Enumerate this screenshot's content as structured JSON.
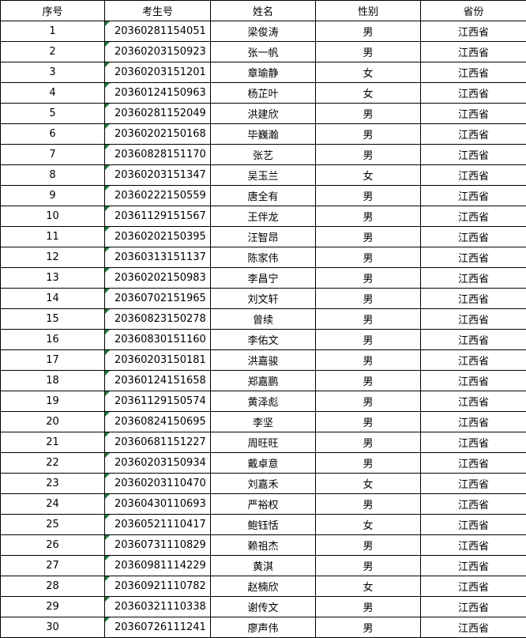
{
  "headers": [
    "序号",
    "考生号",
    "姓名",
    "性别",
    "省份"
  ],
  "rows": [
    [
      "1",
      "20360281154051",
      "梁俊涛",
      "男",
      "江西省"
    ],
    [
      "2",
      "20360203150923",
      "张一帆",
      "男",
      "江西省"
    ],
    [
      "3",
      "20360203151201",
      "章瑜静",
      "女",
      "江西省"
    ],
    [
      "4",
      "20360124150963",
      "杨芷叶",
      "女",
      "江西省"
    ],
    [
      "5",
      "20360281152049",
      "洪建欣",
      "男",
      "江西省"
    ],
    [
      "6",
      "20360202150168",
      "毕巍瀚",
      "男",
      "江西省"
    ],
    [
      "7",
      "20360828151170",
      "张艺",
      "男",
      "江西省"
    ],
    [
      "8",
      "20360203151347",
      "吴玉兰",
      "女",
      "江西省"
    ],
    [
      "9",
      "20360222150559",
      "唐全有",
      "男",
      "江西省"
    ],
    [
      "10",
      "20361129151567",
      "王伴龙",
      "男",
      "江西省"
    ],
    [
      "11",
      "20360202150395",
      "汪智昂",
      "男",
      "江西省"
    ],
    [
      "12",
      "20360313151137",
      "陈家伟",
      "男",
      "江西省"
    ],
    [
      "13",
      "20360202150983",
      "李昌宁",
      "男",
      "江西省"
    ],
    [
      "14",
      "20360702151965",
      "刘文轩",
      "男",
      "江西省"
    ],
    [
      "15",
      "20360823150278",
      "曾续",
      "男",
      "江西省"
    ],
    [
      "16",
      "20360830151160",
      "李佑文",
      "男",
      "江西省"
    ],
    [
      "17",
      "20360203150181",
      "洪嘉骏",
      "男",
      "江西省"
    ],
    [
      "18",
      "20360124151658",
      "郑嘉鹏",
      "男",
      "江西省"
    ],
    [
      "19",
      "20361129150574",
      "黄泽彪",
      "男",
      "江西省"
    ],
    [
      "20",
      "20360824150695",
      "李坚",
      "男",
      "江西省"
    ],
    [
      "21",
      "20360681151227",
      "周旺旺",
      "男",
      "江西省"
    ],
    [
      "22",
      "20360203150934",
      "戴卓意",
      "男",
      "江西省"
    ],
    [
      "23",
      "20360203110470",
      "刘嘉禾",
      "女",
      "江西省"
    ],
    [
      "24",
      "20360430110693",
      "严裕权",
      "男",
      "江西省"
    ],
    [
      "25",
      "20360521110417",
      "鲍钰恬",
      "女",
      "江西省"
    ],
    [
      "26",
      "20360731110829",
      "赖祖杰",
      "男",
      "江西省"
    ],
    [
      "27",
      "20360981114229",
      "黄淇",
      "男",
      "江西省"
    ],
    [
      "28",
      "20360921110782",
      "赵楠欣",
      "女",
      "江西省"
    ],
    [
      "29",
      "20360321110338",
      "谢传文",
      "男",
      "江西省"
    ],
    [
      "30",
      "20360726111241",
      "廖声伟",
      "男",
      "江西省"
    ]
  ],
  "colors": {
    "grid": "#000000",
    "indicator": "#1f7a3a"
  }
}
